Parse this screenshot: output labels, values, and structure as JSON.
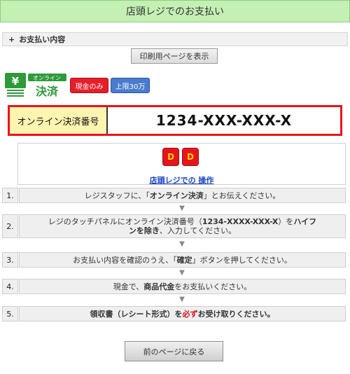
{
  "header": {
    "title": "店頭レジでのお支払い"
  },
  "section": {
    "plus": "+",
    "label": "お支払い内容"
  },
  "print_button": "印刷用ページを表示",
  "logo": {
    "small": "オンライン",
    "big": "決済"
  },
  "badges": {
    "cash_only": "現金のみ",
    "limit": "上限30万"
  },
  "payment_number": {
    "label": "オンライン決済番号",
    "value": "1234-XXX-XXX-X"
  },
  "store": {
    "icon_one": "D",
    "icon_two": "D",
    "link_text": "店頭レジでの 操作"
  },
  "steps": [
    {
      "num": "1.",
      "pre": "レジスタッフに、「",
      "bold": "オンライン決済",
      "post": "」とお伝えください。"
    },
    {
      "num": "2.",
      "pre": "レジのタッチパネルにオンライン決済番号（",
      "bold": "1234-XXXX-XXX-X",
      "mid": "）を",
      "bold2": "ハイフンを除き",
      "post": "、入力してください。"
    },
    {
      "num": "3.",
      "pre": "お支払い内容を確認のうえ、「",
      "bold": "確定",
      "post": "」ボタンを押してください。"
    },
    {
      "num": "4.",
      "pre": "現金で、",
      "bold": "商品代金",
      "post": "をお支払いください。"
    },
    {
      "num": "5.",
      "pre": "領収書（レシート形式）を",
      "red": "必ず",
      "post": "お受け取りください。"
    }
  ],
  "back_button": "前のページに戻る",
  "colors": {
    "header_bg": "#c4f0b4",
    "red": "#e8141c",
    "label_bg": "#fff4b0",
    "link": "#1a44c8"
  }
}
